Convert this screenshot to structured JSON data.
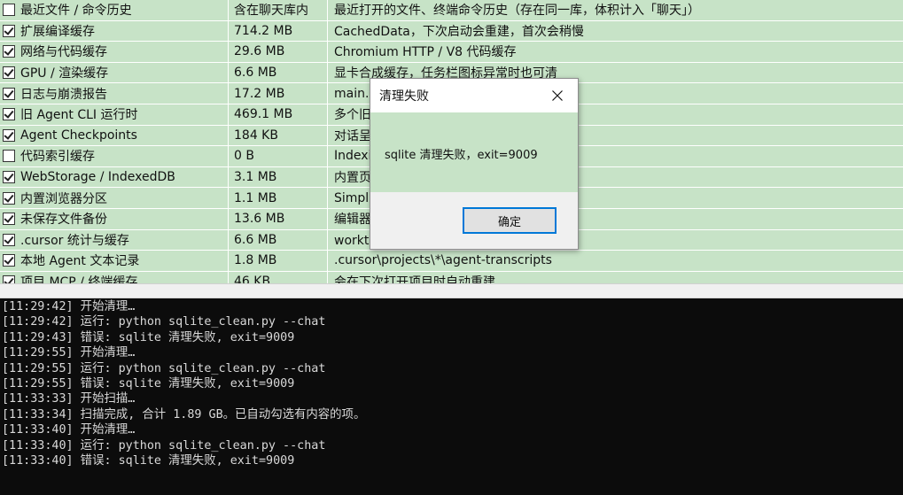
{
  "table": {
    "rows": [
      {
        "checked": false,
        "name": "最近文件 / 命令历史",
        "size": "含在聊天库内",
        "desc": "最近打开的文件、终端命令历史（存在同一库，体积计入「聊天」）"
      },
      {
        "checked": true,
        "name": "扩展编译缓存",
        "size": "714.2 MB",
        "desc": "CachedData，下次启动会重建，首次会稍慢"
      },
      {
        "checked": true,
        "name": "网络与代码缓存",
        "size": "29.6 MB",
        "desc": "Chromium HTTP / V8 代码缓存"
      },
      {
        "checked": true,
        "name": "GPU / 渲染缓存",
        "size": "6.6 MB",
        "desc": "显卡合成缓存，任务栏图标异常时也可清"
      },
      {
        "checked": true,
        "name": "日志与崩溃报告",
        "size": "17.2 MB",
        "desc": "main.l"
      },
      {
        "checked": true,
        "name": "旧 Agent CLI 运行时",
        "size": "469.1 MB",
        "desc": "多个旧"
      },
      {
        "checked": true,
        "name": "Agent Checkpoints",
        "size": "184 KB",
        "desc": "对话呈"
      },
      {
        "checked": false,
        "name": "代码索引缓存",
        "size": "0 B",
        "desc": "Indexi"
      },
      {
        "checked": true,
        "name": "WebStorage / IndexedDB",
        "size": "3.1 MB",
        "desc": "内置页"
      },
      {
        "checked": true,
        "name": "内置浏览器分区",
        "size": "1.1 MB",
        "desc": "Simpl"
      },
      {
        "checked": true,
        "name": "未保存文件备份",
        "size": "13.6 MB",
        "desc": "编辑器"
      },
      {
        "checked": true,
        "name": ".cursor 统计与缓存",
        "size": "6.6 MB",
        "desc": "workt                                    化日志"
      },
      {
        "checked": true,
        "name": "本地 Agent 文本记录",
        "size": "1.8 MB",
        "desc": ".cursor\\projects\\*\\agent-transcripts"
      },
      {
        "checked": true,
        "name": "项目 MCP / 终端缓存",
        "size": "46 KB",
        "desc": "会在下次打开项目时自动重建"
      }
    ]
  },
  "log": {
    "lines": [
      "[11:29:42] 开始清理…",
      "[11:29:42] 运行: python sqlite_clean.py --chat",
      "[11:29:43] 错误: sqlite 清理失败, exit=9009",
      "[11:29:55] 开始清理…",
      "[11:29:55] 运行: python sqlite_clean.py --chat",
      "[11:29:55] 错误: sqlite 清理失败, exit=9009",
      "[11:33:33] 开始扫描…",
      "[11:33:34] 扫描完成, 合计 1.89 GB。已自动勾选有内容的项。",
      "[11:33:40] 开始清理…",
      "[11:33:40] 运行: python sqlite_clean.py --chat",
      "[11:33:40] 错误: sqlite 清理失败, exit=9009"
    ]
  },
  "dialog": {
    "title": "清理失败",
    "message": "sqlite 清理失败，exit=9009",
    "ok_label": "确定",
    "close_icon": "close-icon"
  },
  "colors": {
    "row_bg": "#c7e3c7",
    "log_bg": "#0c0c0c",
    "log_text": "#d9d9d9",
    "accent": "#0078d7"
  }
}
